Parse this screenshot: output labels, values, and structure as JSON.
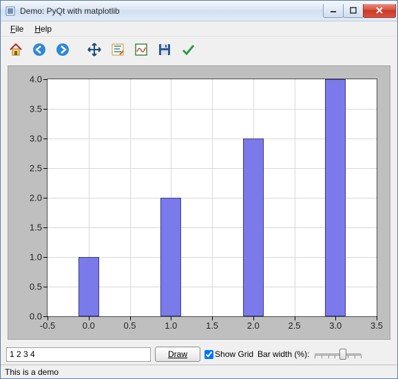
{
  "window": {
    "title": "Demo: PyQt with matplotlib"
  },
  "menubar": {
    "file": "File",
    "help": "Help"
  },
  "toolbar": {
    "home": "home-icon",
    "back": "back-icon",
    "forward": "forward-icon",
    "pan": "pan-icon",
    "zoom": "zoom-icon",
    "subplots": "subplots-icon",
    "save": "save-icon",
    "check": "check-icon"
  },
  "chart_data": {
    "type": "bar",
    "categories": [
      0,
      1,
      2,
      3
    ],
    "values": [
      1,
      2,
      3,
      4
    ],
    "bar_width": 0.25,
    "xlim": [
      -0.5,
      3.5
    ],
    "ylim": [
      0.0,
      4.0
    ],
    "xticks": [
      -0.5,
      0.0,
      0.5,
      1.0,
      1.5,
      2.0,
      2.5,
      3.0,
      3.5
    ],
    "yticks": [
      0.0,
      0.5,
      1.0,
      1.5,
      2.0,
      2.5,
      3.0,
      3.5,
      4.0
    ],
    "grid": true,
    "title": "",
    "xlabel": "",
    "ylabel": ""
  },
  "controls": {
    "data_input": "1 2 3 4",
    "draw_label": "Draw",
    "show_grid_label": "Show Grid",
    "show_grid_checked": true,
    "bar_width_label": "Bar width (%):",
    "bar_width_value": 25
  },
  "statusbar": {
    "text": "This is a demo"
  }
}
